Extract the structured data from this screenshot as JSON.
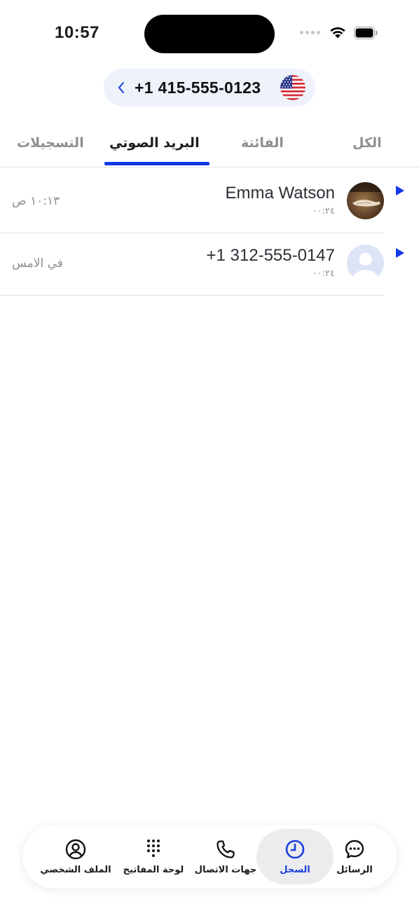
{
  "status_bar": {
    "time": "10:57"
  },
  "header": {
    "phone_number": "+1 415-555-0123",
    "flag": "us-flag-icon"
  },
  "tabs": [
    {
      "label": "الكل",
      "active": false
    },
    {
      "label": "الفائتة",
      "active": false
    },
    {
      "label": "البريد الصوتي",
      "active": true
    },
    {
      "label": "التسجيلات",
      "active": false
    }
  ],
  "voicemails": [
    {
      "name": "Emma Watson",
      "duration": "٠٠:٢٤",
      "time": "١٠:١٣ ص",
      "avatar": "photo-avatar"
    },
    {
      "name": "+1 312-555-0147",
      "duration": "٠٠:٢٤",
      "time": "في الامس",
      "avatar": "default-avatar"
    }
  ],
  "nav": {
    "messages": "الرسائل",
    "history": "السجل",
    "contacts": "جهات الاتصال",
    "keypad": "لوحة المفاتيح",
    "profile": "الملف الشخصي",
    "active": "history"
  },
  "colors": {
    "accent": "#1239e8",
    "pill_bg": "#eef2fa"
  }
}
